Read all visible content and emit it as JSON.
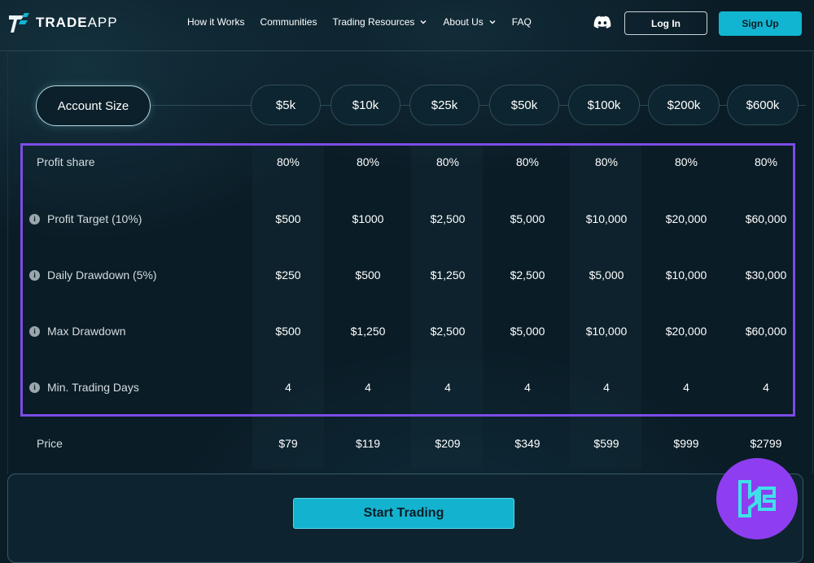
{
  "brand": {
    "name_part1": "TRADE",
    "name_part2": "APP"
  },
  "nav": {
    "items": [
      {
        "label": "How it Works",
        "dropdown": false
      },
      {
        "label": "Communities",
        "dropdown": false
      },
      {
        "label": "Trading Resources",
        "dropdown": true
      },
      {
        "label": "About Us",
        "dropdown": true
      },
      {
        "label": "FAQ",
        "dropdown": false
      }
    ]
  },
  "header": {
    "login_label": "Log In",
    "signup_label": "Sign Up",
    "discord_icon": "discord-icon"
  },
  "account_size": {
    "label": "Account Size",
    "options": [
      "$5k",
      "$10k",
      "$25k",
      "$50k",
      "$100k",
      "$200k",
      "$600k"
    ]
  },
  "table": {
    "rows": [
      {
        "label": "Profit share",
        "info": false,
        "values": [
          "80%",
          "80%",
          "80%",
          "80%",
          "80%",
          "80%",
          "80%"
        ]
      },
      {
        "label": "Profit Target (10%)",
        "info": true,
        "values": [
          "$500",
          "$1000",
          "$2,500",
          "$5,000",
          "$10,000",
          "$20,000",
          "$60,000"
        ]
      },
      {
        "label": "Daily Drawdown (5%)",
        "info": true,
        "values": [
          "$250",
          "$500",
          "$1,250",
          "$2,500",
          "$5,000",
          "$10,000",
          "$30,000"
        ]
      },
      {
        "label": "Max Drawdown",
        "info": true,
        "values": [
          "$500",
          "$1,250",
          "$2,500",
          "$5,000",
          "$10,000",
          "$20,000",
          "$60,000"
        ]
      },
      {
        "label": "Min. Trading Days",
        "info": true,
        "values": [
          "4",
          "4",
          "4",
          "4",
          "4",
          "4",
          "4"
        ]
      },
      {
        "label": "Price",
        "info": false,
        "values": [
          "$79",
          "$119",
          "$209",
          "$349",
          "$599",
          "$999",
          "$2799"
        ]
      }
    ]
  },
  "cta": {
    "start_label": "Start Trading"
  },
  "colors": {
    "accent": "#12b5d1",
    "highlight": "#7c4ce6",
    "background": "#0a1c26",
    "watermark": "#8e3ef0"
  }
}
